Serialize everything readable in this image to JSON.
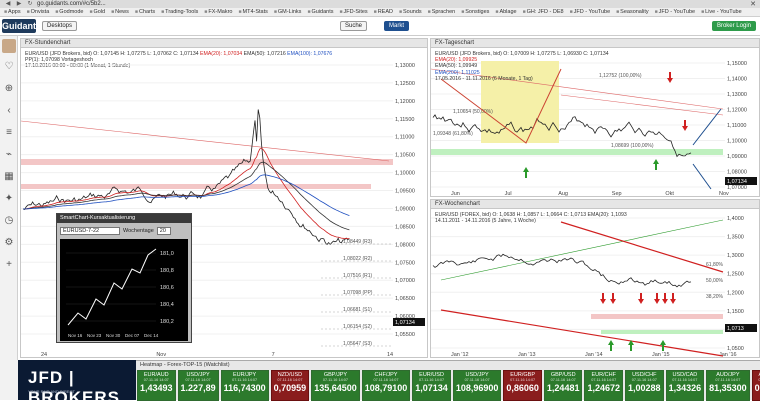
{
  "browser": {
    "url": "go.guidants.com/#c/5b2...",
    "bookmarks": [
      "Apps",
      "Onvista",
      "Godmode",
      "Gold",
      "News",
      "Charts",
      "Trading-Tools",
      "FX-Makro",
      "MT4-Stats",
      "GM-Links",
      "Guidants",
      "JFD-Sites",
      "READ",
      "Sounds",
      "Sprachen",
      "Sonstiges",
      "Ablage",
      "GH: JFD - DE8",
      "JFD - YouTube",
      "Seasonality",
      "JFD - YouTube",
      "Live - YouTube"
    ]
  },
  "app": {
    "logo": "Guidants",
    "desktop_button": "Desktops",
    "search_button": "Suche",
    "markets_button": "Markt",
    "broker_button": "Broker Login"
  },
  "panels": {
    "hourly": {
      "title": "FX-Stundenchart",
      "legend1": "EUR/USD (JFD Brokers, bid)  O: 1,07145  H: 1,07275  L: 1,07062  C: 1,07134",
      "legend_ema20": "EMA(20): 1,07034",
      "legend_ema50": "EMA(50): 1,07216",
      "legend_ema100": "EMA(100): 1,07676",
      "legend2": "PP(1): 1,07098  Vortageshoch",
      "legend3": "17.10.2016 00:00 - 00:00  (1 Monat, 1 Stunde)",
      "price_labels": [
        "1,13000",
        "1,12500",
        "1,12000",
        "1,11500",
        "1,11000",
        "1,10500",
        "1,10000",
        "1,09500",
        "1,09000",
        "1,08500",
        "1,08000",
        "1,07500",
        "1,07000",
        "1,06500",
        "1,06000",
        "1,05500"
      ],
      "x_labels": [
        "24",
        "Nov",
        "7",
        "14"
      ],
      "annotations": [
        "1,08449 (R3)",
        "1,08022 (R2)",
        "1,07516 (R1)",
        "1,07098 (PP)",
        "1,06681 (S1)",
        "1,06154 (S2)",
        "1,05647 (S3)"
      ],
      "last_price": "1,07134"
    },
    "daily": {
      "title": "FX-Tageschart",
      "legend1": "EUR/USD (JFD Brokers, bid)  O: 1,07009  H: 1,07275  L: 1,06930  C: 1,07134",
      "legend_ema20": "EMA(20): 1,09925",
      "legend_ema50": "EMA(50): 1,09949",
      "legend_ema200": "EMA(200): 1,11025",
      "legend3": "17.05.2016 - 11.11.2016  (6 Monate, 1 Tag)",
      "price_labels": [
        "1,15000",
        "1,14000",
        "1,13000",
        "1,12000",
        "1,11000",
        "1,10000",
        "1,09000",
        "1,08000",
        "1,07000"
      ],
      "x_labels": [
        "Jun",
        "Jul",
        "Aug",
        "Sep",
        "Okt",
        "Nov"
      ],
      "fib_labels": [
        "1,12752 (100,00%)",
        "1,10654 (50,00%)",
        "1,09348 (61,80%)",
        "1,08699 (100,00%)"
      ],
      "last_price": "1,07134"
    },
    "weekly": {
      "title": "FX-Wochenchart",
      "legend1": "EUR/USD (FOREX, bid)  O: 1,0638  H: 1,0857  L: 1,0664  C: 1,0713  EMA(20): 1,1093",
      "legend3": "14.11.2011 - 14.11.2016  (5 Jahre, 1 Woche)",
      "price_labels": [
        "1,4000",
        "1,3500",
        "1,3000",
        "1,2500",
        "1,2000",
        "1,1500",
        "1,1000",
        "1,0500"
      ],
      "x_labels": [
        "Jan '12",
        "Jan '13",
        "Jan '14",
        "Jan '15",
        "Jan '16"
      ],
      "fib_labels": [
        "61,80%",
        "50,00%",
        "38,20%"
      ],
      "last_price": "1,0713"
    }
  },
  "popup": {
    "title": "SmartChart-Kursaktualisierung",
    "symbol": "EURUSD-7-22",
    "label": "Wochentage",
    "count": "20",
    "prices": [
      "181,0",
      "180,8",
      "180,6",
      "180,4",
      "180,2"
    ],
    "dates": [
      "Nov 16",
      "Nov 23",
      "Nov 30",
      "Dec 07",
      "Dec 14"
    ]
  },
  "heatmap": {
    "title": "Heatmap - Forex-TOP-15 (Watchlist)",
    "cells": [
      {
        "sym": "EUR/AUD",
        "sub": "07.11.16 14:07",
        "val": "1,43493",
        "color": "green"
      },
      {
        "sym": "USD/JPY",
        "sub": "07.11.16 14:07",
        "val": "1.227,89",
        "color": "green"
      },
      {
        "sym": "EUR/JPY",
        "sub": "07.11.16 14:07",
        "val": "116,74300",
        "color": "green"
      },
      {
        "sym": "NZD/USD",
        "sub": "07.11.16 14:07",
        "val": "0,70959",
        "color": "red"
      },
      {
        "sym": "GBP/JPY",
        "sub": "07.11.16 14:07",
        "val": "135,64500",
        "color": "green"
      },
      {
        "sym": "CHF/JPY",
        "sub": "07.11.16 14:07",
        "val": "108,79100",
        "color": "green"
      },
      {
        "sym": "EUR/USD",
        "sub": "07.11.16 14:07",
        "val": "1,07134",
        "color": "green"
      },
      {
        "sym": "USD/JPY",
        "sub": "07.11.16 14:07",
        "val": "108,96900",
        "color": "green"
      },
      {
        "sym": "EUR/GBP",
        "sub": "07.11.16 14:07",
        "val": "0,86060",
        "color": "red"
      },
      {
        "sym": "GBP/USD",
        "sub": "07.11.16 14:07",
        "val": "1,24481",
        "color": "green"
      },
      {
        "sym": "EUR/CHF",
        "sub": "07.11.16 14:07",
        "val": "1,24672",
        "color": "green"
      },
      {
        "sym": "USD/CHF",
        "sub": "07.11.16 14:07",
        "val": "1,00288",
        "color": "green"
      },
      {
        "sym": "USD/CAD",
        "sub": "07.11.16 14:07",
        "val": "1,34326",
        "color": "green"
      },
      {
        "sym": "AUD/JPY",
        "sub": "07.11.16 14:07",
        "val": "81,35300",
        "color": "green"
      },
      {
        "sym": "AUD/USD",
        "sub": "07.11.16 14:07",
        "val": "0,74659",
        "color": "red"
      }
    ]
  },
  "brand": {
    "name": "JFD | BROKERS",
    "sub": "YOUR FAIR AND DIRECT"
  },
  "colors": {
    "accent_red": "#d02020",
    "accent_green": "#2c7a2c",
    "brand_navy": "#0b1a33"
  }
}
